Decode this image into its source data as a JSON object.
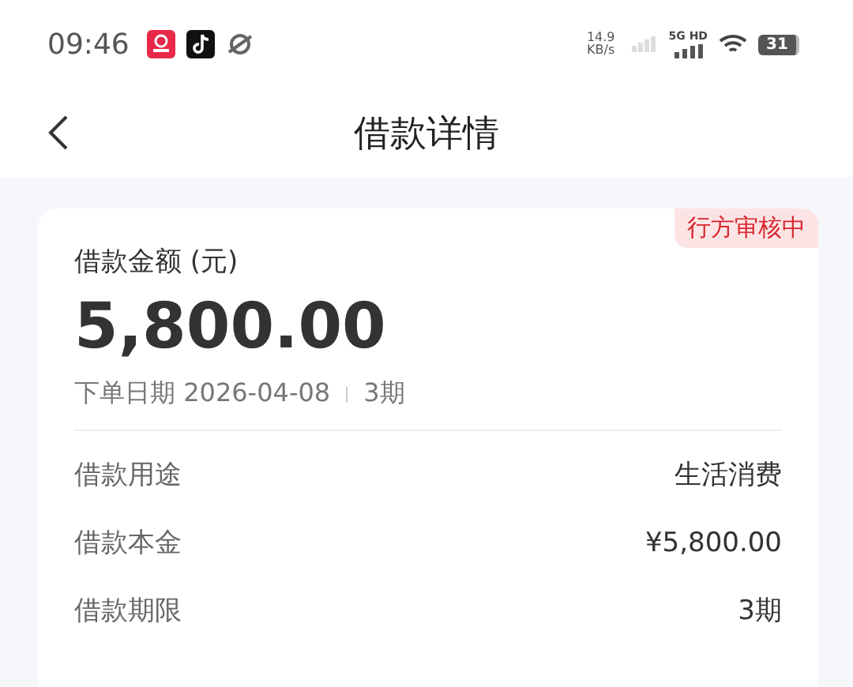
{
  "status_bar": {
    "time": "09:46",
    "speed_value": "14.9",
    "speed_unit": "KB/s",
    "network": "5G HD",
    "battery": "31"
  },
  "header": {
    "title": "借款详情"
  },
  "summary": {
    "status_badge": "行方审核中",
    "amount_label": "借款金额 (元)",
    "amount": "5,800.00",
    "order_date_label": "下单日期 2026-04-08",
    "installments": "3期"
  },
  "details": [
    {
      "label": "借款用途",
      "value": "生活消费"
    },
    {
      "label": "借款本金",
      "value": "¥5,800.00"
    },
    {
      "label": "借款期限",
      "value": "3期"
    }
  ]
}
